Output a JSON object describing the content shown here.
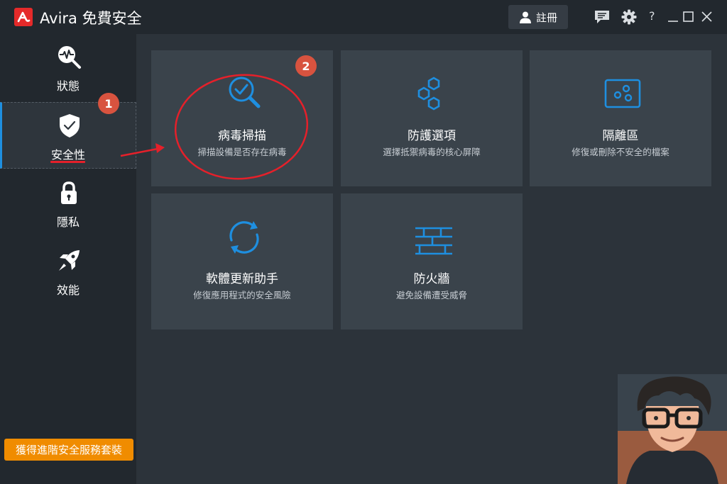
{
  "app": {
    "name": "Avira",
    "product": "免費安全"
  },
  "titlebar": {
    "register_label": "註冊",
    "help_label": "?"
  },
  "sidebar": {
    "items": [
      {
        "label": "狀態",
        "icon": "status-icon"
      },
      {
        "label": "安全性",
        "icon": "shield-icon"
      },
      {
        "label": "隱私",
        "icon": "lock-icon"
      },
      {
        "label": "效能",
        "icon": "rocket-icon"
      }
    ],
    "active": "安全性",
    "upgrade_label": "獲得進階安全服務套裝"
  },
  "tiles": [
    {
      "title": "病毒掃描",
      "subtitle": "掃描設備是否存在病毒",
      "icon": "virus-scan-icon"
    },
    {
      "title": "防護選項",
      "subtitle": "選擇抵禦病毒的核心屏障",
      "icon": "protection-options-icon"
    },
    {
      "title": "隔離區",
      "subtitle": "修復或刪除不安全的檔案",
      "icon": "quarantine-icon"
    },
    {
      "title": "軟體更新助手",
      "subtitle": "修復應用程式的安全風險",
      "icon": "software-updater-icon"
    },
    {
      "title": "防火牆",
      "subtitle": "避免設備遭受威脅",
      "icon": "firewall-icon"
    }
  ],
  "annotations": {
    "badge_1": "1",
    "badge_2": "2"
  },
  "colors": {
    "accent_blue": "#1e8fe0",
    "brand_red": "#e52a2a",
    "upgrade_orange": "#f08c00",
    "annotation_red": "#e5202a"
  }
}
